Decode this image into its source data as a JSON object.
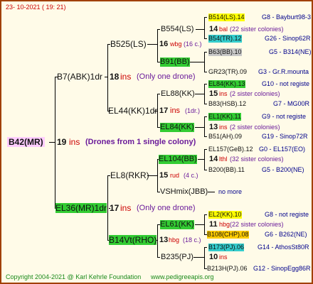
{
  "header": {
    "date": "23- 10-2021 ( 19: 21)"
  },
  "footer": {
    "copyright": "Copyright 2004-2021 @ Karl Kehrle Foundation",
    "website": "www.pedigreeapis.org"
  },
  "root": {
    "label": "B42(MR)",
    "number": "19",
    "unit": "ins",
    "note": "(Drones from 1 single colony)"
  },
  "gen1": [
    {
      "label": "B7(ABK)1dr",
      "number": "18",
      "unit": "ins",
      "note": "(Only one drone)"
    },
    {
      "label": "EL36(MR)1dr",
      "number": "17",
      "unit": "ins",
      "note": "(Only one drone)"
    }
  ],
  "gen2": [
    {
      "label": "B525(LS)",
      "number": "16",
      "unit": "wbg",
      "note": "(16 c.)"
    },
    {
      "label": "EL44(KK)1dr",
      "number": "17",
      "unit": "ins",
      "note": "(1dr.)"
    },
    {
      "label": "EL8(RKR)",
      "number": "15",
      "unit": "rud",
      "note": "(4 c.)"
    },
    {
      "label": "B14Vt(RHO)",
      "number": "13",
      "unit": "hbg",
      "note": "(18 c.)"
    }
  ],
  "gen3": [
    {
      "label": "B554(LS)",
      "number": "14",
      "unit": "bal",
      "note": "(22 sister colonies)"
    },
    {
      "label": "B91(BB)",
      "number": "",
      "unit": "",
      "note": ""
    },
    {
      "label": "EL88(KK)",
      "number": "15",
      "unit": "ins",
      "note": "(2 sister colonies)"
    },
    {
      "label": "EL84(KK)",
      "number": "13",
      "unit": "ins",
      "note": "(2 sister colonies)"
    },
    {
      "label": "EL104(BB)",
      "number": "14",
      "unit": "lthl",
      "note": "(32 sister colonies)"
    },
    {
      "label": "VSHmix(JBB)",
      "number": "",
      "unit": "",
      "note": "no more"
    },
    {
      "label": "EL61(KK)",
      "number": "11",
      "unit": "hbg",
      "note": "(22 sister colonies)"
    },
    {
      "label": "B235(PJ)",
      "number": "10",
      "unit": "ins",
      "note": ""
    }
  ],
  "gen4": [
    {
      "label": "B514(LS).14",
      "ref": "G8 - Bayburt98-3"
    },
    {
      "label": "B54(TR).12",
      "ref": "G26 - Sinop62R"
    },
    {
      "label": "B63(BB).10",
      "ref": "G5 - B314(NE)"
    },
    {
      "label": "GR23(TR).09",
      "ref": "G3 - Gr.R.mounta"
    },
    {
      "label": "EL84(KK).13",
      "ref": "G10 - not registe"
    },
    {
      "label": "B83(HSB).12",
      "ref": "G7 - MG00R"
    },
    {
      "label": "EL1(KK).11",
      "ref": "G9 - not registe"
    },
    {
      "label": "B51(AH).09",
      "ref": "G19 - Sinop72R"
    },
    {
      "label": "EL157(GeB).12",
      "ref": "G0 - EL157(EO)"
    },
    {
      "label": "B200(BB).11",
      "ref": "G5 - B200(NE)"
    },
    {
      "label": "EL2(KK).10",
      "ref": "G8 - not registe"
    },
    {
      "label": "B108(CHP).08",
      "ref": "G6 - B262(NE)"
    },
    {
      "label": "B173(PJ).06",
      "ref": "G14 - AthosSt80R"
    },
    {
      "label": "B213H(PJ).06",
      "ref": "G12 - SinopEgg86R"
    }
  ]
}
